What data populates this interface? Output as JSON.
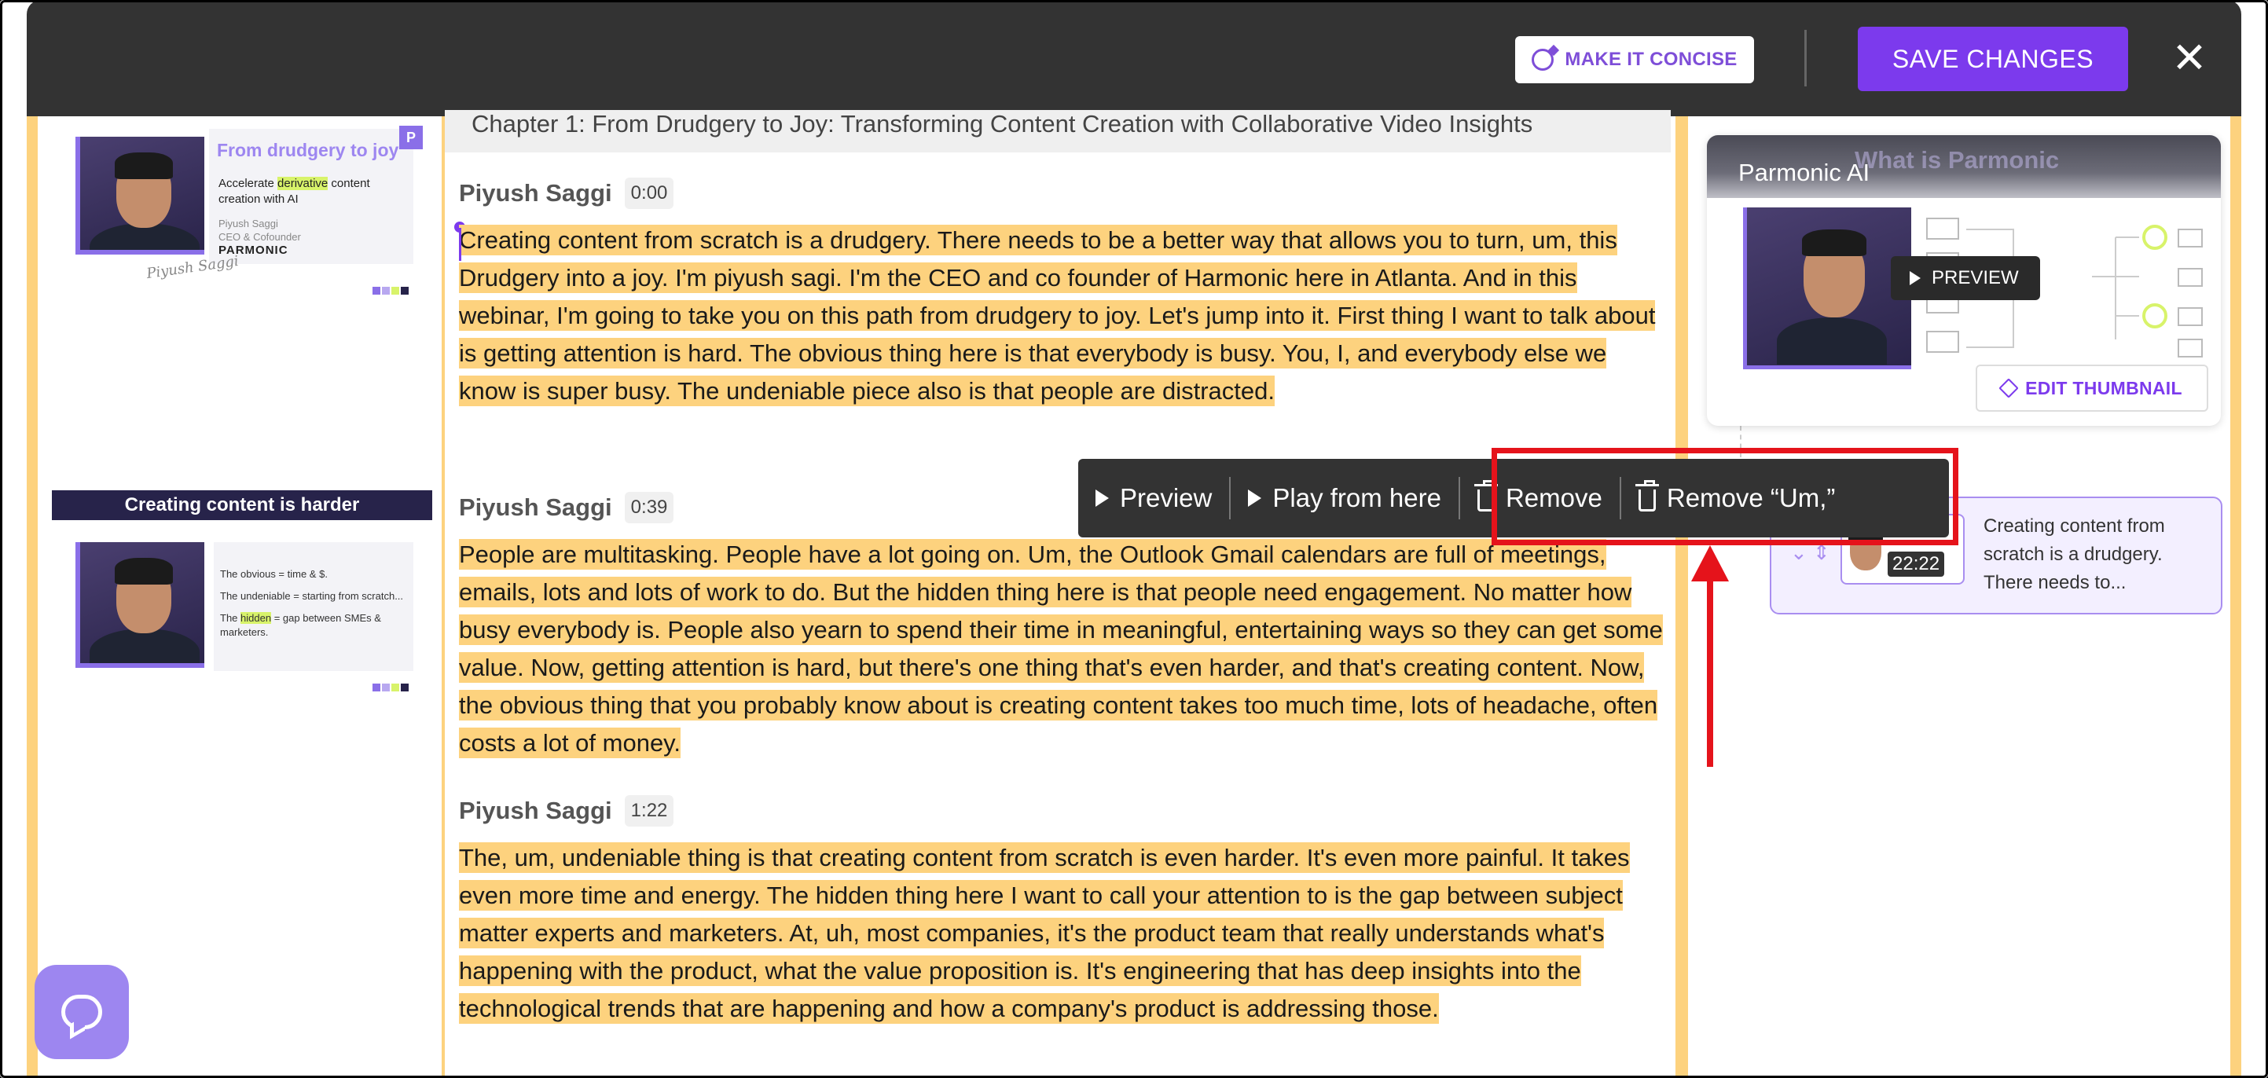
{
  "toolbar": {
    "concise_label": "MAKE IT CONCISE",
    "save_label": "SAVE CHANGES"
  },
  "slides": {
    "slide1": {
      "title": "From drudgery to joy",
      "subtitle_pre": "Accelerate",
      "subtitle_hl": "derivative",
      "subtitle_post": "content creation with AI",
      "name": "Piyush Saggi",
      "role": "CEO & Cofounder",
      "brand": "PARMONIC",
      "badge": "P",
      "signature": "Piyush Saggi"
    },
    "slide2": {
      "header": "Creating content is harder",
      "line1": "The obvious = time & $.",
      "line2": "The undeniable = starting from scratch...",
      "line3_pre": "The",
      "line3_hl": "hidden",
      "line3_post": "= gap between SMEs & marketers."
    }
  },
  "transcript": {
    "chapter": "Chapter 1: From Drudgery to Joy: Transforming Content Creation with Collaborative Video Insights",
    "blocks": [
      {
        "speaker": "Piyush Saggi",
        "time": "0:00",
        "text": "Creating content from scratch is a drudgery. There needs to be a better way that allows you to turn, um, this Drudgery into a joy. I'm piyush sagi. I'm the CEO and co founder of Harmonic here in Atlanta. And in this webinar, I'm going to take you on this path from drudgery to joy. Let's jump into it. First thing I want to talk about is getting attention is hard. The obvious thing here is that everybody is busy. You, I, and everybody else we know is super busy. The undeniable piece also is that people are distracted. "
      },
      {
        "speaker": "Piyush Saggi",
        "time": "0:39",
        "text": "People are multitasking. People have a lot going on. Um, the Outlook Gmail calendars are full of meetings, emails, lots and lots of work to do. But the hidden thing here is that people need engagement. No matter how busy everybody is. People also yearn to spend their time in meaningful, entertaining ways so they can get some value. Now, getting attention is hard, but there's one thing that's even harder, and that's creating content. Now, the obvious thing that you probably know about is creating content takes too much time, lots of headache, often costs a lot of money. "
      },
      {
        "speaker": "Piyush Saggi",
        "time": "1:22",
        "text": "The, um, undeniable thing is that creating content from scratch is even harder. It's even more painful. It takes even more time and energy. The hidden thing here I want to call your attention to is the gap between subject matter experts and marketers. At, uh, most companies, it's the product team that really understands what's happening with the product, what the value proposition is. It's engineering that has deep insights into the technological trends that are happening and how a company's product is addressing those. "
      }
    ]
  },
  "context_menu": {
    "preview": "Preview",
    "play_from_here": "Play from here",
    "remove": "Remove",
    "remove_um": "Remove “Um,”"
  },
  "video_card": {
    "title": "Parmonic AI",
    "ghost_title": "What is Parmonic",
    "preview_label": "PREVIEW",
    "edit_label": "EDIT THUMBNAIL"
  },
  "clip": {
    "duration": "22:22",
    "text": "Creating content from scratch is a drudgery. There needs to..."
  },
  "colors": {
    "accent": "#7c3aed",
    "highlight": "#fdd27e",
    "annotation": "#e5131b",
    "topbar": "#333333"
  }
}
